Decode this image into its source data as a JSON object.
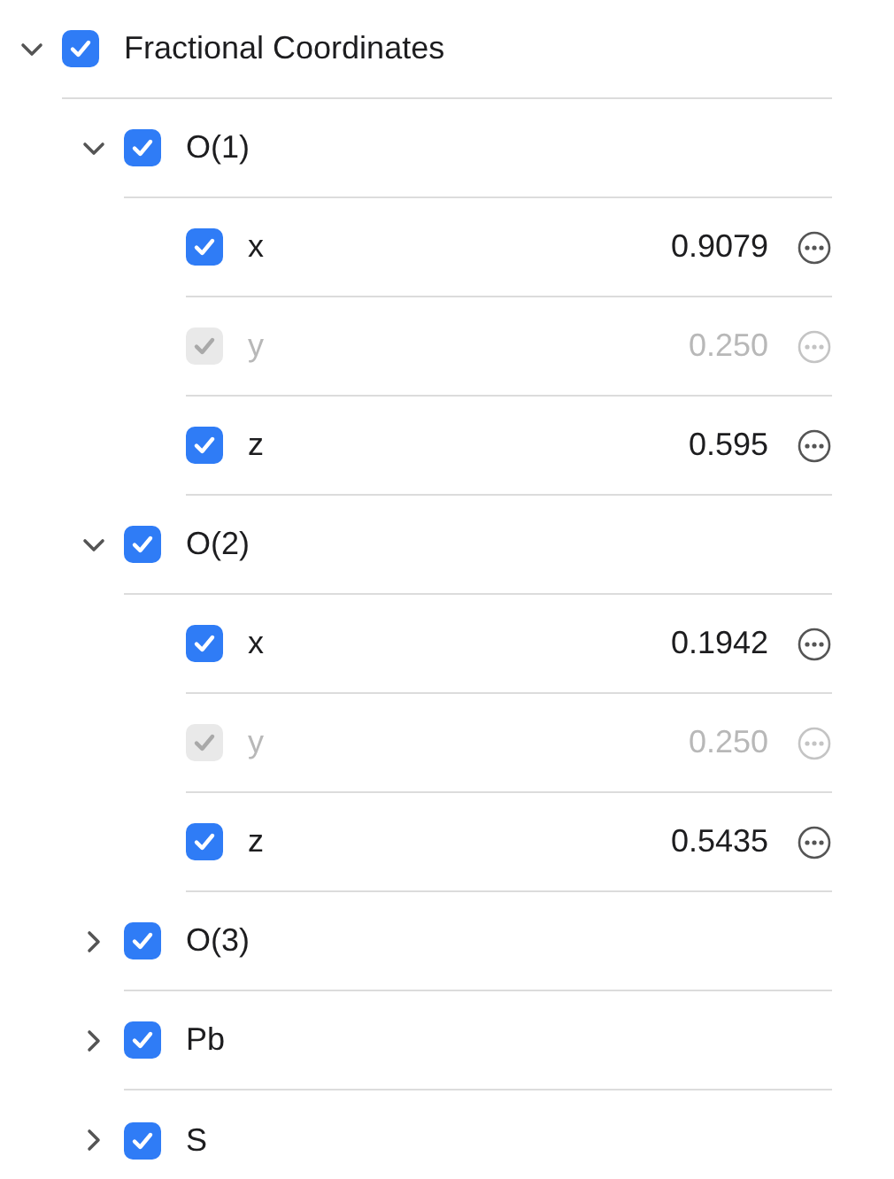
{
  "tree": [
    {
      "kind": "group",
      "label": "Fractional Coordinates",
      "checked": true,
      "expanded": true,
      "children": [
        {
          "kind": "group",
          "label": "O(1)",
          "checked": true,
          "expanded": true,
          "children": [
            {
              "kind": "value",
              "label": "x",
              "value": "0.9079",
              "checked": true,
              "disabled": false
            },
            {
              "kind": "value",
              "label": "y",
              "value": "0.250",
              "checked": true,
              "disabled": true
            },
            {
              "kind": "value",
              "label": "z",
              "value": "0.595",
              "checked": true,
              "disabled": false
            }
          ]
        },
        {
          "kind": "group",
          "label": "O(2)",
          "checked": true,
          "expanded": true,
          "children": [
            {
              "kind": "value",
              "label": "x",
              "value": "0.1942",
              "checked": true,
              "disabled": false
            },
            {
              "kind": "value",
              "label": "y",
              "value": "0.250",
              "checked": true,
              "disabled": true
            },
            {
              "kind": "value",
              "label": "z",
              "value": "0.5435",
              "checked": true,
              "disabled": false
            }
          ]
        },
        {
          "kind": "group",
          "label": "O(3)",
          "checked": true,
          "expanded": false
        },
        {
          "kind": "group",
          "label": "Pb",
          "checked": true,
          "expanded": false
        },
        {
          "kind": "group",
          "label": "S",
          "checked": true,
          "expanded": false
        }
      ]
    }
  ]
}
